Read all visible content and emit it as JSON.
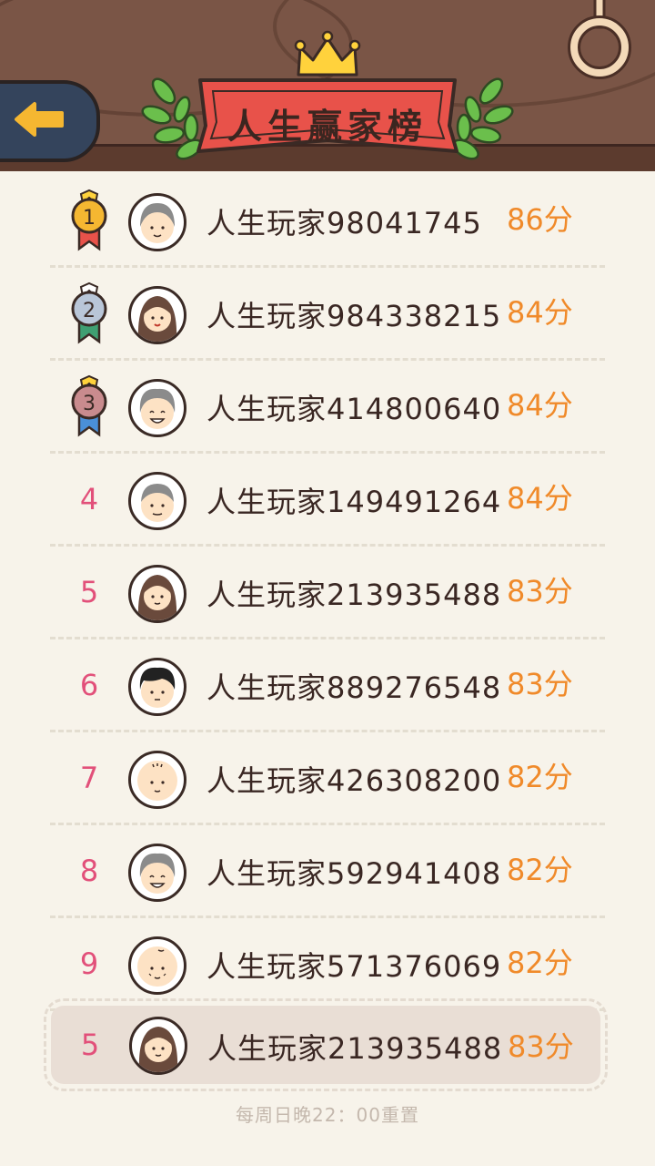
{
  "title": "人生赢家榜",
  "players": [
    {
      "rank": "1",
      "name": "人生玩家98041745",
      "score": "86分",
      "medal": "gold",
      "avatar": "grandma-gray-icon"
    },
    {
      "rank": "2",
      "name": "人生玩家984338215",
      "score": "84分",
      "medal": "silver",
      "avatar": "woman-brown-hair-icon"
    },
    {
      "rank": "3",
      "name": "人生玩家414800640",
      "score": "84分",
      "medal": "bronze",
      "avatar": "grandma-smiling-icon"
    },
    {
      "rank": "4",
      "name": "人生玩家149491264",
      "score": "84分",
      "avatar": "grandpa-gray-icon"
    },
    {
      "rank": "5",
      "name": "人生玩家213935488",
      "score": "83分",
      "avatar": "woman-brown-hair-icon"
    },
    {
      "rank": "6",
      "name": "人生玩家889276548",
      "score": "83分",
      "avatar": "young-man-black-hair-icon"
    },
    {
      "rank": "7",
      "name": "人生玩家426308200",
      "score": "82分",
      "avatar": "bald-man-icon"
    },
    {
      "rank": "8",
      "name": "人生玩家592941408",
      "score": "82分",
      "avatar": "grandma-smiling-icon"
    },
    {
      "rank": "9",
      "name": "人生玩家571376069",
      "score": "82分",
      "avatar": "old-bald-man-icon"
    }
  ],
  "my_rank": {
    "rank": "5",
    "name": "人生玩家213935488",
    "score": "83分",
    "avatar": "woman-brown-hair-icon"
  },
  "footer": "每周日晚22：00重置",
  "colors": {
    "header": "#7a5546",
    "banner": "#e8524a",
    "rank": "#e2507a",
    "score": "#f08a2a",
    "background": "#f7f3ea"
  }
}
